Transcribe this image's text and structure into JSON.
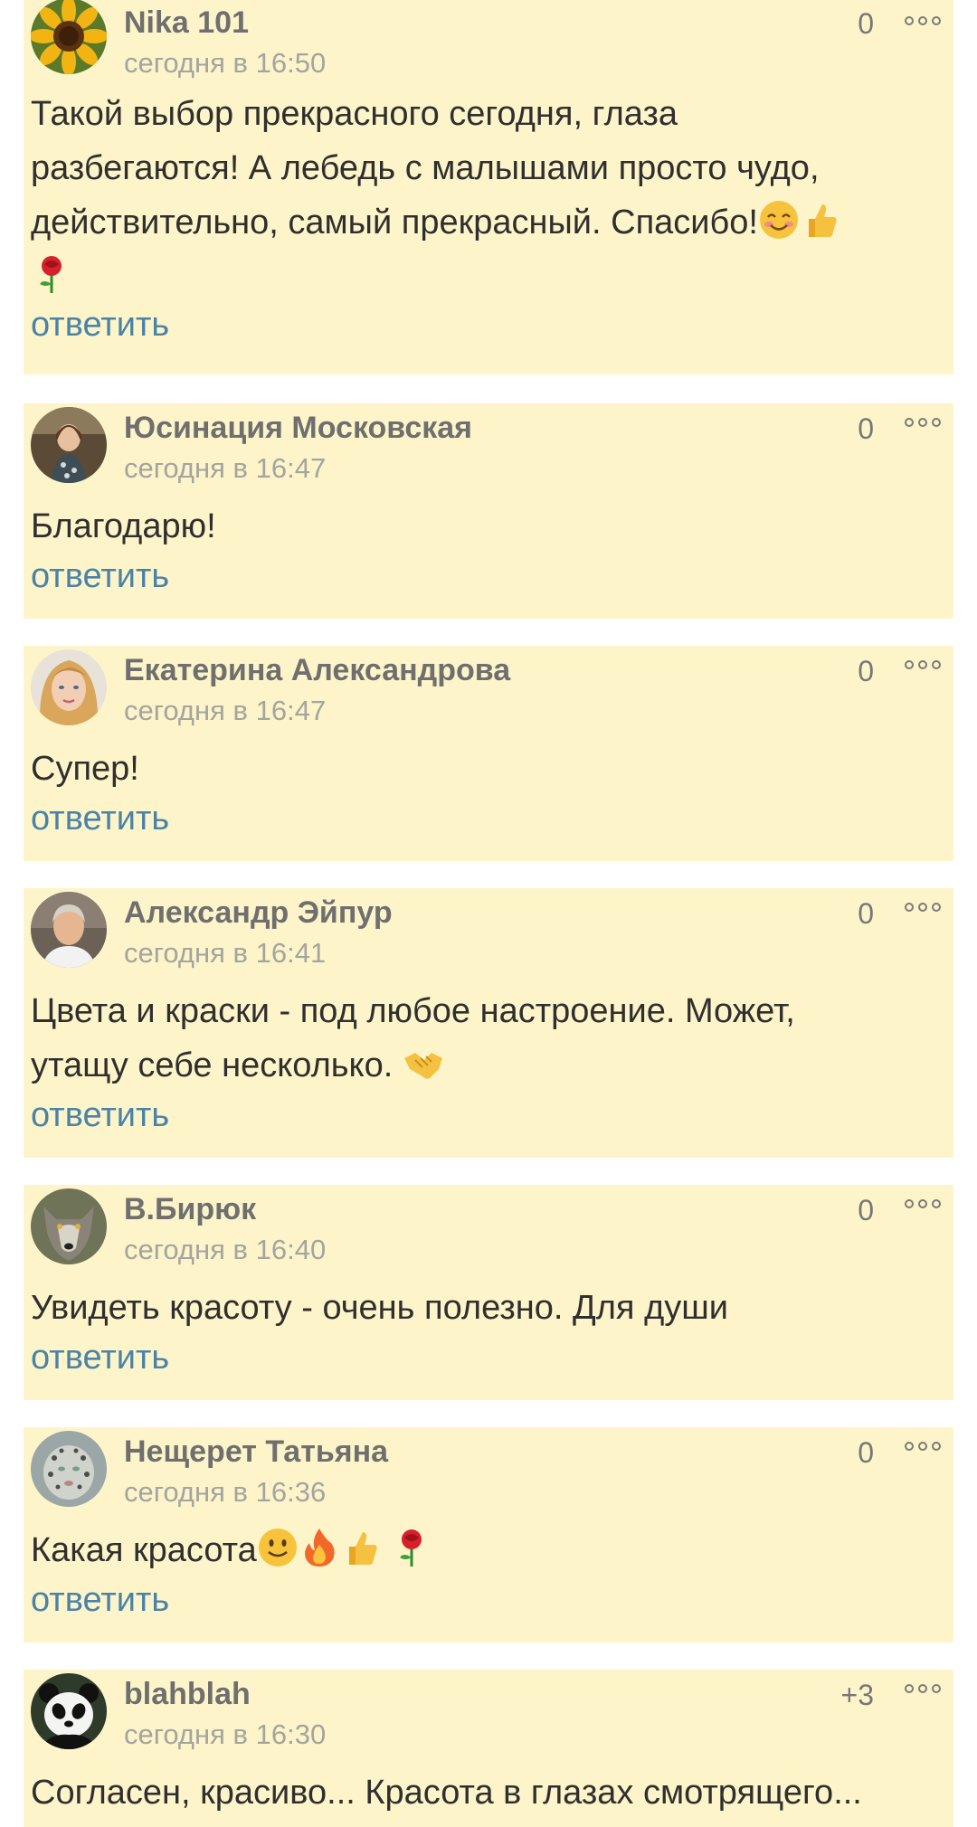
{
  "colors": {
    "card_bg": "#fdf5c9",
    "author": "#6f6f6f",
    "time": "#a4a4a0",
    "reply_link": "#4a82a8"
  },
  "comments": [
    {
      "author": "Nika 101",
      "time": "сегодня в 16:50",
      "votes": "0",
      "avatar": "sunflower",
      "lines": [
        "Такой выбор прекрасного сегодня, глаза",
        "разбегаются! А лебедь с малышами просто чудо,",
        "действительно, самый прекрасный. Спасибо!"
      ],
      "emoji": [
        "smiling-face-icon",
        "thumbs-up-icon",
        "rose-icon"
      ],
      "reply": "ответить"
    },
    {
      "author": "Юсинация Московская",
      "time": "сегодня в 16:47",
      "votes": "0",
      "avatar": "woman-photo",
      "lines": [
        "Благодарю!"
      ],
      "reply": "ответить"
    },
    {
      "author": "Екатерина Александрова",
      "time": "сегодня в 16:47",
      "votes": "0",
      "avatar": "blonde-woman",
      "lines": [
        "Супер!"
      ],
      "reply": "ответить"
    },
    {
      "author": "Александр Эйпур",
      "time": "сегодня в 16:41",
      "votes": "0",
      "avatar": "man-photo",
      "lines": [
        "Цвета и краски - под любое настроение. Может,",
        "утащу себе несколько."
      ],
      "emoji": [
        "handshake-icon"
      ],
      "reply": "ответить"
    },
    {
      "author": "В.Бирюк",
      "time": "сегодня в 16:40",
      "votes": "0",
      "avatar": "wolf",
      "lines": [
        "Увидеть красоту - очень полезно. Для души"
      ],
      "reply": "ответить"
    },
    {
      "author": "Нещерет Татьяна",
      "time": "сегодня в 16:36",
      "votes": "0",
      "avatar": "snow-leopard",
      "lines": [
        "Какая красота"
      ],
      "emoji": [
        "slightly-smiling-face-icon",
        "fire-icon",
        "thumbs-up-icon",
        "rose-icon"
      ],
      "reply": "ответить"
    },
    {
      "author": "blahblah",
      "time": "сегодня в 16:30",
      "votes": "+3",
      "avatar": "panda",
      "lines": [
        "Согласен, красиво... Красота в глазах смотрящего..."
      ]
    }
  ]
}
